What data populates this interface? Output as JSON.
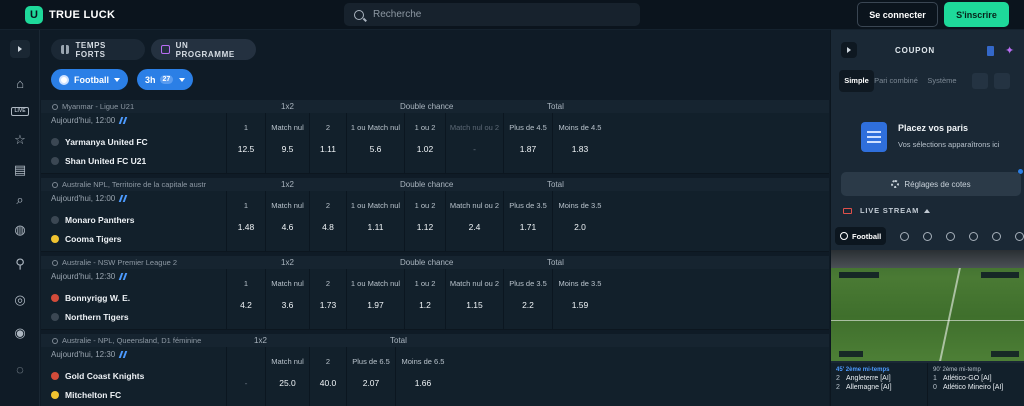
{
  "brand": {
    "name": "TRUE LUCK",
    "logo_letter": "U"
  },
  "header": {
    "search_placeholder": "Recherche",
    "login_label": "Se connecter",
    "signup_label": "S'inscrire"
  },
  "tabs": [
    {
      "label": "TEMPS FORTS"
    },
    {
      "label": "UN PROGRAMME"
    }
  ],
  "filters": {
    "sport": "Football",
    "time": "3h",
    "count": "27"
  },
  "rail": {
    "live_label": "LIVE"
  },
  "matches": [
    {
      "league": "Myanmar - Ligue U21",
      "markets": [
        "1x2",
        "Double chance",
        "Total"
      ],
      "time": "Aujourd'hui, 12:00",
      "home": "Yarmanya United FC",
      "away": "Shan United FC U21",
      "odds": [
        {
          "label": "1",
          "value": "12.5"
        },
        {
          "label": "Match nul",
          "value": "9.5"
        },
        {
          "label": "2",
          "value": "1.11"
        },
        {
          "label": "1 ou Match nul",
          "value": "5.6"
        },
        {
          "label": "1 ou 2",
          "value": "1.02"
        },
        {
          "label": "Match nul ou 2",
          "value": "-"
        },
        {
          "label": "Plus de 4.5",
          "value": "1.87"
        },
        {
          "label": "Moins de 4.5",
          "value": "1.83"
        }
      ]
    },
    {
      "league": "Australie NPL, Territoire de la capitale austr",
      "markets": [
        "1x2",
        "Double chance",
        "Total"
      ],
      "time": "Aujourd'hui, 12:00",
      "home": "Monaro Panthers",
      "away": "Cooma Tigers",
      "odds": [
        {
          "label": "1",
          "value": "1.48"
        },
        {
          "label": "Match nul",
          "value": "4.6"
        },
        {
          "label": "2",
          "value": "4.8"
        },
        {
          "label": "1 ou Match nul",
          "value": "1.11"
        },
        {
          "label": "1 ou 2",
          "value": "1.12"
        },
        {
          "label": "Match nul ou 2",
          "value": "2.4"
        },
        {
          "label": "Plus de 3.5",
          "value": "1.71"
        },
        {
          "label": "Moins de 3.5",
          "value": "2.0"
        }
      ]
    },
    {
      "league": "Australie - NSW Premier League 2",
      "markets": [
        "1x2",
        "Double chance",
        "Total"
      ],
      "time": "Aujourd'hui, 12:30",
      "home": "Bonnyrigg W. E.",
      "away": "Northern Tigers",
      "odds": [
        {
          "label": "1",
          "value": "4.2"
        },
        {
          "label": "Match nul",
          "value": "3.6"
        },
        {
          "label": "2",
          "value": "1.73"
        },
        {
          "label": "1 ou Match nul",
          "value": "1.97"
        },
        {
          "label": "1 ou 2",
          "value": "1.2"
        },
        {
          "label": "Match nul ou 2",
          "value": "1.15"
        },
        {
          "label": "Plus de 3.5",
          "value": "2.2"
        },
        {
          "label": "Moins de 3.5",
          "value": "1.59"
        }
      ]
    },
    {
      "league": "Australie - NPL, Queensland, D1 féminine",
      "markets": [
        "1x2",
        "Total"
      ],
      "time": "Aujourd'hui, 12:30",
      "home": "Gold Coast Knights",
      "away": "Mitchelton FC",
      "odds": [
        {
          "label": "",
          "value": "-"
        },
        {
          "label": "Match nul",
          "value": "25.0"
        },
        {
          "label": "2",
          "value": "40.0"
        },
        {
          "label": "Plus de 6.5",
          "value": "2.07"
        },
        {
          "label": "Moins de 6.5",
          "value": "1.66"
        }
      ]
    }
  ],
  "coupon": {
    "title": "COUPON",
    "tabs": [
      "Simple",
      "Pari combiné",
      "Système"
    ],
    "empty_title": "Placez vos paris",
    "empty_sub": "Vos sélections apparaîtrons ici",
    "odds_settings": "Réglages de cotes"
  },
  "live_stream": {
    "title": "LIVE STREAM",
    "active_sport": "Football",
    "events": [
      {
        "status": "45' 2ème mi-temps",
        "lines": [
          {
            "score": "2",
            "team": "Angleterre [AI]"
          },
          {
            "score": "2",
            "team": "Allemagne [AI]"
          }
        ]
      },
      {
        "status": "90' 2ème mi-temp",
        "lines": [
          {
            "score": "1",
            "team": "Atlético-GO [AI]"
          },
          {
            "score": "0",
            "team": "Atlético Mineiro [AI]"
          }
        ]
      }
    ]
  }
}
